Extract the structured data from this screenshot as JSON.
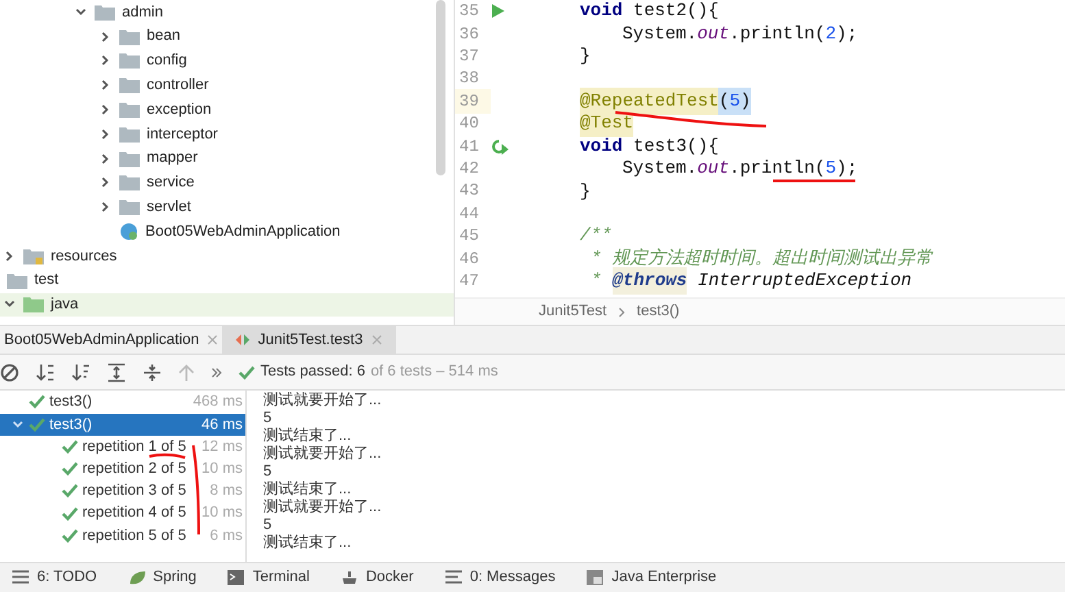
{
  "packages": [
    {
      "label": "admin",
      "kind": "folder",
      "expanded": true,
      "children": [
        {
          "label": "bean",
          "kind": "folder",
          "expanded": false
        },
        {
          "label": "config",
          "kind": "folder",
          "expanded": false
        },
        {
          "label": "controller",
          "kind": "folder",
          "expanded": false
        },
        {
          "label": "exception",
          "kind": "folder",
          "expanded": false
        },
        {
          "label": "interceptor",
          "kind": "folder",
          "expanded": false
        },
        {
          "label": "mapper",
          "kind": "folder",
          "expanded": false
        },
        {
          "label": "service",
          "kind": "folder",
          "expanded": false
        },
        {
          "label": "servlet",
          "kind": "folder",
          "expanded": false
        },
        {
          "label": "Boot05WebAdminApplication",
          "kind": "app"
        }
      ]
    }
  ],
  "main_folders": [
    {
      "label": "resources",
      "kind": "resources",
      "expanded": false
    }
  ],
  "test_root": {
    "label": "test",
    "kind": "folder",
    "children": [
      {
        "label": "java",
        "kind": "test_sources",
        "expanded": true,
        "selected": true
      }
    ]
  },
  "editor": {
    "lines": [
      {
        "number": "35",
        "kind": "method_run",
        "highlighted": false,
        "tokens": [
          {
            "text": "void ",
            "kind": "keyword"
          },
          {
            "text": "test2(){",
            "kind": "plain"
          }
        ]
      },
      {
        "number": "36",
        "kind": "body",
        "highlighted": false,
        "tokens": [
          {
            "text": "System.",
            "kind": "plain"
          },
          {
            "text": "out",
            "kind": "field"
          },
          {
            "text": ".println(",
            "kind": "plain"
          },
          {
            "text": "2",
            "kind": "number"
          },
          {
            "text": ");",
            "kind": "plain"
          }
        ]
      },
      {
        "number": "37",
        "kind": "method",
        "highlighted": false,
        "tokens": [
          {
            "text": "}",
            "kind": "plain"
          }
        ]
      },
      {
        "number": "38",
        "kind": "blank",
        "highlighted": false
      },
      {
        "number": "39",
        "kind": "method",
        "highlighted": true,
        "tokens": [
          {
            "text": "@RepeatedTest",
            "kind": "annotation"
          },
          {
            "text": "(",
            "kind": "paren_match"
          },
          {
            "text": "5",
            "kind": "number_match"
          },
          {
            "text": ")",
            "kind": "paren_match"
          }
        ]
      },
      {
        "number": "40",
        "kind": "method",
        "highlighted": false,
        "tokens": [
          {
            "text": "@Test",
            "kind": "annotation"
          }
        ]
      },
      {
        "number": "41",
        "kind": "method_rerun",
        "highlighted": false,
        "tokens": [
          {
            "text": "void ",
            "kind": "keyword"
          },
          {
            "text": "test3(){",
            "kind": "plain"
          }
        ]
      },
      {
        "number": "42",
        "kind": "body",
        "highlighted": false,
        "tokens": [
          {
            "text": "System.",
            "kind": "plain"
          },
          {
            "text": "out",
            "kind": "field"
          },
          {
            "text": ".println(",
            "kind": "plain"
          },
          {
            "text": "5",
            "kind": "number"
          },
          {
            "text": ");",
            "kind": "plain"
          }
        ]
      },
      {
        "number": "43",
        "kind": "method",
        "highlighted": false,
        "tokens": [
          {
            "text": "}",
            "kind": "plain"
          }
        ]
      },
      {
        "number": "44",
        "kind": "blank",
        "highlighted": false
      },
      {
        "number": "45",
        "kind": "method",
        "highlighted": false,
        "tokens": [
          {
            "text": "/**",
            "kind": "doc"
          }
        ]
      },
      {
        "number": "46",
        "kind": "doc",
        "highlighted": false,
        "tokens": [
          {
            "text": "* ",
            "kind": "doc"
          },
          {
            "text": "规定方法超时时间。超出时间测试出异常",
            "kind": "doc_italic"
          }
        ]
      },
      {
        "number": "47",
        "kind": "doc",
        "highlighted": false,
        "tokens": [
          {
            "text": "* ",
            "kind": "doc"
          },
          {
            "text": "@throws",
            "kind": "doc_tag"
          },
          {
            "text": " InterruptedException",
            "kind": "doc_type"
          }
        ]
      }
    ],
    "breadcrumb": [
      "Junit5Test",
      "test3()"
    ]
  },
  "run_tabs": [
    {
      "label": "Boot05WebAdminApplication",
      "kind": "app",
      "selected": false
    },
    {
      "label": "Junit5Test.test3",
      "kind": "junit",
      "selected": true
    }
  ],
  "run_status": {
    "passed": "Tests passed: 6",
    "detail": "of 6 tests – 514 ms"
  },
  "test_tree": [
    {
      "label": "test3()",
      "time": "468 ms",
      "selected": false
    },
    {
      "label": "test3()",
      "time": "46 ms",
      "selected": true,
      "expanded": true,
      "children": [
        {
          "label": "repetition 1 of 5",
          "time": "12 ms"
        },
        {
          "label": "repetition 2 of 5",
          "time": "10 ms"
        },
        {
          "label": "repetition 3 of 5",
          "time": "8 ms"
        },
        {
          "label": "repetition 4 of 5",
          "time": "10 ms"
        },
        {
          "label": "repetition 5 of 5",
          "time": "6 ms"
        }
      ]
    }
  ],
  "console": [
    "测试就要开始了...",
    "5",
    "测试结束了...",
    "测试就要开始了...",
    "5",
    "测试结束了...",
    "测试就要开始了...",
    "5",
    "测试结束了..."
  ],
  "tool_windows": [
    {
      "label": "6: TODO",
      "kind": "todo"
    },
    {
      "label": "Spring",
      "kind": "spring"
    },
    {
      "label": "Terminal",
      "kind": "terminal"
    },
    {
      "label": "Docker",
      "kind": "docker"
    },
    {
      "label": "0: Messages",
      "kind": "messages"
    },
    {
      "label": "Java Enterprise",
      "kind": "enterprise"
    }
  ]
}
